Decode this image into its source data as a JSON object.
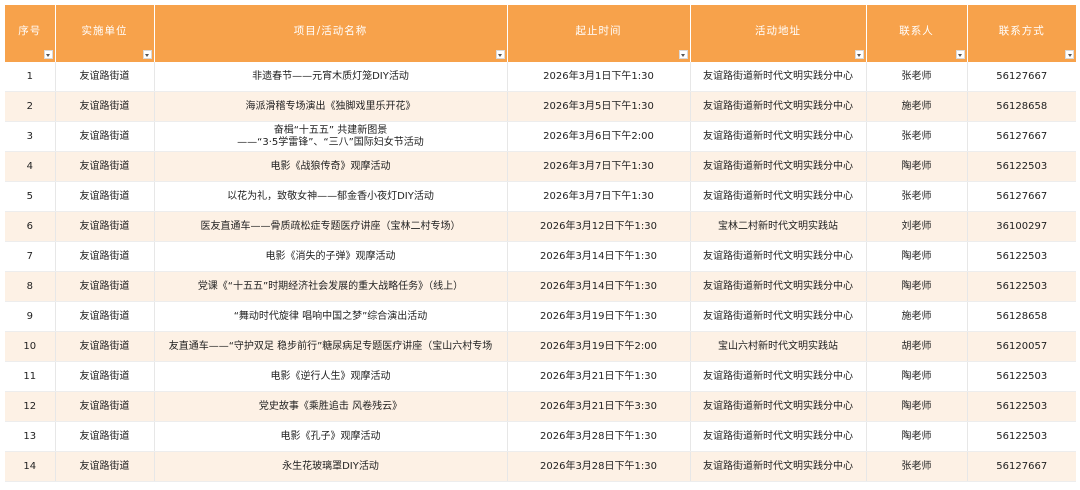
{
  "headers": {
    "index": "序号",
    "unit": "实施单位",
    "project": "项目/活动名称",
    "time": "起止时间",
    "address": "活动地址",
    "contact": "联系人",
    "phone": "联系方式"
  },
  "rows": [
    {
      "index": "1",
      "unit": "友谊路街道",
      "project": "非遗春节——元宵木质灯笼DIY活动",
      "project_line2": "",
      "time": "2026年3月1日下午1:30",
      "address": "友谊路街道新时代文明实践分中心",
      "contact": "张老师",
      "phone": "56127667"
    },
    {
      "index": "2",
      "unit": "友谊路街道",
      "project": "海派滑稽专场演出《独脚戏里乐开花》",
      "project_line2": "",
      "time": "2026年3月5日下午1:30",
      "address": "友谊路街道新时代文明实践分中心",
      "contact": "施老师",
      "phone": "56128658"
    },
    {
      "index": "3",
      "unit": "友谊路街道",
      "project": "奋楫“十五五” 共建新图景",
      "project_line2": "——“3·5学雷锋”、“三八”国际妇女节活动",
      "time": "2026年3月6日下午2:00",
      "address": "友谊路街道新时代文明实践分中心",
      "contact": "张老师",
      "phone": "56127667"
    },
    {
      "index": "4",
      "unit": "友谊路街道",
      "project": "电影《战狼传奇》观摩活动",
      "project_line2": "",
      "time": "2026年3月7日下午1:30",
      "address": "友谊路街道新时代文明实践分中心",
      "contact": "陶老师",
      "phone": "56122503"
    },
    {
      "index": "5",
      "unit": "友谊路街道",
      "project": "以花为礼，致敬女神——郁金香小夜灯DIY活动",
      "project_line2": "",
      "time": "2026年3月7日下午1:30",
      "address": "友谊路街道新时代文明实践分中心",
      "contact": "张老师",
      "phone": "56127667"
    },
    {
      "index": "6",
      "unit": "友谊路街道",
      "project": "医友直通车——骨质疏松症专题医疗讲座（宝林二村专场）",
      "project_line2": "",
      "time": "2026年3月12日下午1:30",
      "address": "宝林二村新时代文明实践站",
      "contact": "刘老师",
      "phone": "36100297"
    },
    {
      "index": "7",
      "unit": "友谊路街道",
      "project": "电影《消失的子弹》观摩活动",
      "project_line2": "",
      "time": "2026年3月14日下午1:30",
      "address": "友谊路街道新时代文明实践分中心",
      "contact": "陶老师",
      "phone": "56122503"
    },
    {
      "index": "8",
      "unit": "友谊路街道",
      "project": "党课《“十五五”时期经济社会发展的重大战略任务》（线上）",
      "project_line2": "",
      "time": "2026年3月14日下午1:30",
      "address": "友谊路街道新时代文明实践分中心",
      "contact": "陶老师",
      "phone": "56122503"
    },
    {
      "index": "9",
      "unit": "友谊路街道",
      "project": "“舞动时代旋律 唱响中国之梦”综合演出活动",
      "project_line2": "",
      "time": "2026年3月19日下午1:30",
      "address": "友谊路街道新时代文明实践分中心",
      "contact": "施老师",
      "phone": "56128658"
    },
    {
      "index": "10",
      "unit": "友谊路街道",
      "project": "友直通车——“守护双足 稳步前行”糖尿病足专题医疗讲座（宝山六村专场",
      "project_line2": "",
      "time": "2026年3月19日下午2:00",
      "address": "宝山六村新时代文明实践站",
      "contact": "胡老师",
      "phone": "56120057"
    },
    {
      "index": "11",
      "unit": "友谊路街道",
      "project": "电影《逆行人生》观摩活动",
      "project_line2": "",
      "time": "2026年3月21日下午1:30",
      "address": "友谊路街道新时代文明实践分中心",
      "contact": "陶老师",
      "phone": "56122503"
    },
    {
      "index": "12",
      "unit": "友谊路街道",
      "project": "党史故事《乘胜追击 风卷残云》",
      "project_line2": "",
      "time": "2026年3月21日下午3:30",
      "address": "友谊路街道新时代文明实践分中心",
      "contact": "陶老师",
      "phone": "56122503"
    },
    {
      "index": "13",
      "unit": "友谊路街道",
      "project": "电影《孔子》观摩活动",
      "project_line2": "",
      "time": "2026年3月28日下午1:30",
      "address": "友谊路街道新时代文明实践分中心",
      "contact": "陶老师",
      "phone": "56122503"
    },
    {
      "index": "14",
      "unit": "友谊路街道",
      "project": "永生花玻璃罩DIY活动",
      "project_line2": "",
      "time": "2026年3月28日下午1:30",
      "address": "友谊路街道新时代文明实践分中心",
      "contact": "张老师",
      "phone": "56127667"
    }
  ],
  "colors": {
    "header_bg": "#f7a24b",
    "header_text": "#ffffff",
    "stripe": "#fdf1e5"
  }
}
